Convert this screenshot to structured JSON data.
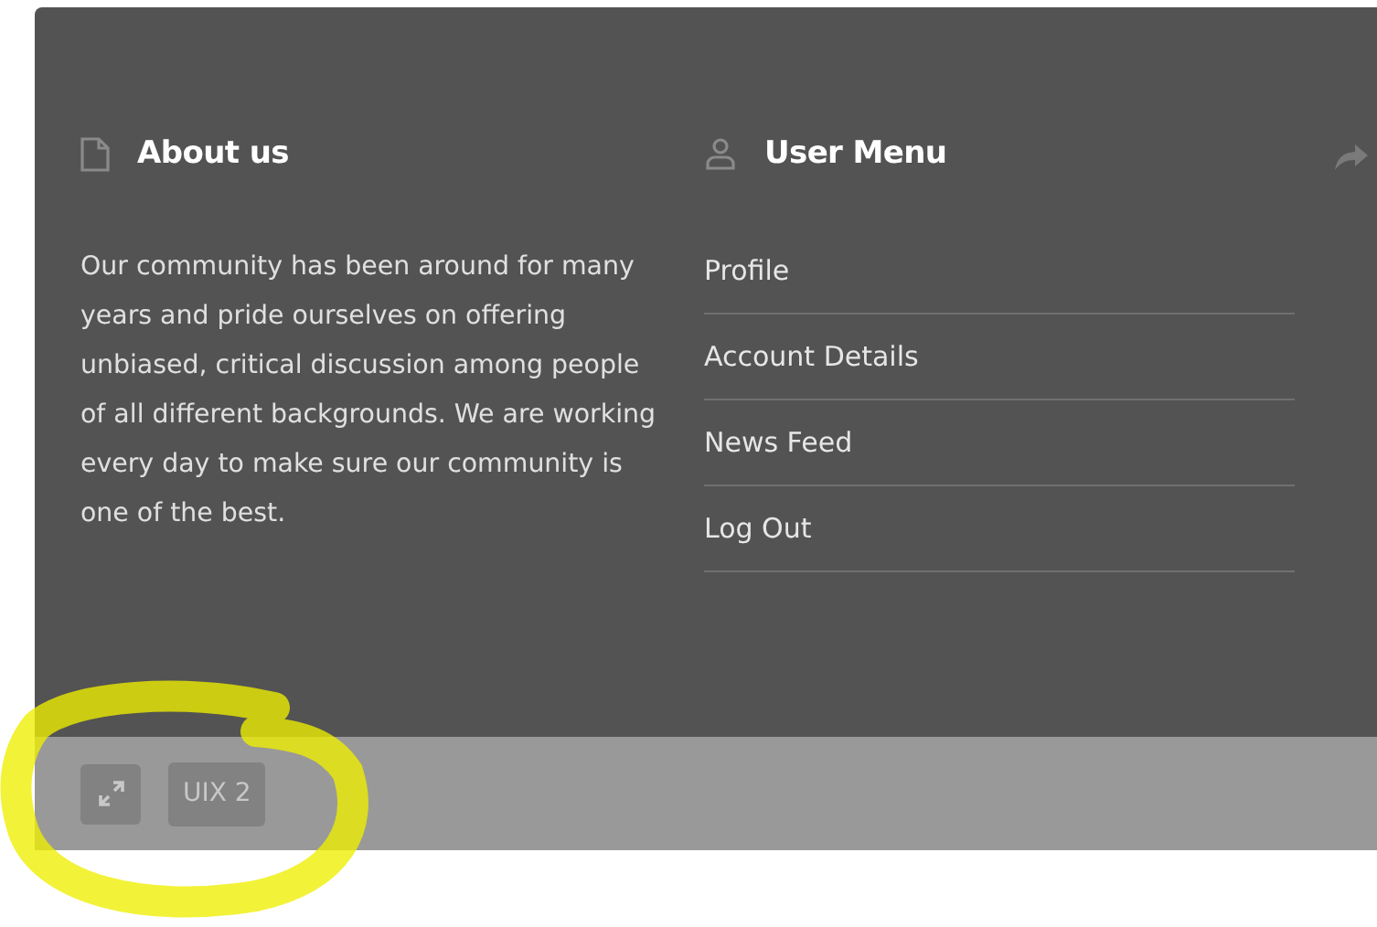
{
  "about": {
    "title": "About us",
    "text": "Our community has been around for many years and pride ourselves on offering unbiased, critical discussion among people of all different backgrounds. We are working every day to make sure our community is one of the best."
  },
  "user_menu": {
    "title": "User Menu",
    "items": [
      {
        "label": "Profile"
      },
      {
        "label": "Account Details"
      },
      {
        "label": "News Feed"
      },
      {
        "label": "Log Out"
      }
    ]
  },
  "footer_bar": {
    "style_button": "UIX 2"
  }
}
